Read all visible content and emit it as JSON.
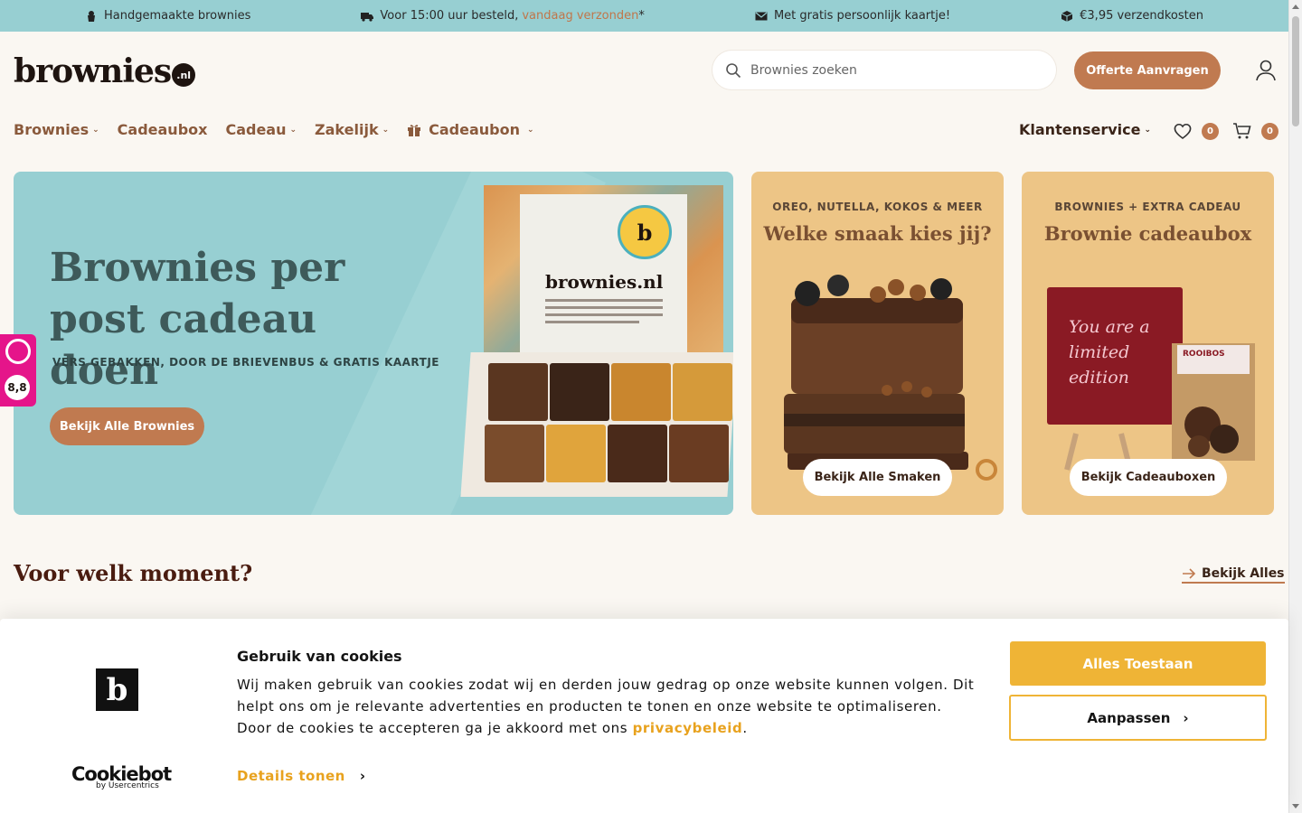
{
  "topbar": {
    "usp1": "Handgemaakte brownies",
    "usp2_pre": "Voor 15:00 uur besteld,",
    "usp2_hl": "vandaag verzonden",
    "usp2_post": "*",
    "usp3": "Met gratis persoonlijk kaartje!",
    "usp4": "€3,95 verzendkosten"
  },
  "header": {
    "logo_text": "brownies",
    "logo_suffix": ".nl",
    "search_placeholder": "Brownies zoeken",
    "offerte_label": "Offerte Aanvragen"
  },
  "nav": {
    "items": [
      {
        "label": "Brownies",
        "dropdown": true
      },
      {
        "label": "Cadeaubox",
        "dropdown": false
      },
      {
        "label": "Cadeau",
        "dropdown": true
      },
      {
        "label": "Zakelijk",
        "dropdown": true
      },
      {
        "label": "Cadeaubon",
        "dropdown": true
      }
    ],
    "service_label": "Klantenservice",
    "wishlist_count": "0",
    "cart_count": "0"
  },
  "hero": {
    "title": "Brownies per post cadeau doen",
    "subtitle": "VERS GEBAKKEN, DOOR DE BRIEVENBUS & GRATIS KAARTJE",
    "button": "Bekijk Alle Brownies",
    "box_brand": "brownies.nl",
    "seal_letter": "b"
  },
  "cards": [
    {
      "kicker": "OREO, NUTELLA, KOKOS & MEER",
      "title": "Welke smaak kies jij?",
      "button": "Bekijk Alle Smaken"
    },
    {
      "kicker": "BROWNIES + EXTRA CADEAU",
      "title": "Brownie cadeaubox",
      "button": "Bekijk Cadeauboxen",
      "card_text": "You are a limited edition",
      "bag_text": "ROOIBOS"
    }
  ],
  "section": {
    "title": "Voor welk moment?",
    "see_all": "Bekijk Alles"
  },
  "rating": {
    "score": "8,8"
  },
  "cookie": {
    "brand_letter": "b",
    "title": "Gebruik van cookies",
    "text": "Wij maken gebruik van cookies zodat wij en derden jouw gedrag op onze website kunnen volgen. Dit helpt ons om je relevante advertenties en producten te tonen en onze website te optimaliseren. Door de cookies te accepteren ga je akkoord met ons",
    "link": "privacybeleid",
    "text_end": ".",
    "details": "Details tonen",
    "allow_all": "Alles Toestaan",
    "customize": "Aanpassen",
    "cookiebot": "Cookiebot",
    "cookiebot_sub": "by Usercentrics"
  },
  "colors": {
    "accent": "#c07a50",
    "topbar_bg": "#97cfd2",
    "cookie_yellow": "#efb436",
    "rating_pink": "#e5158a"
  }
}
